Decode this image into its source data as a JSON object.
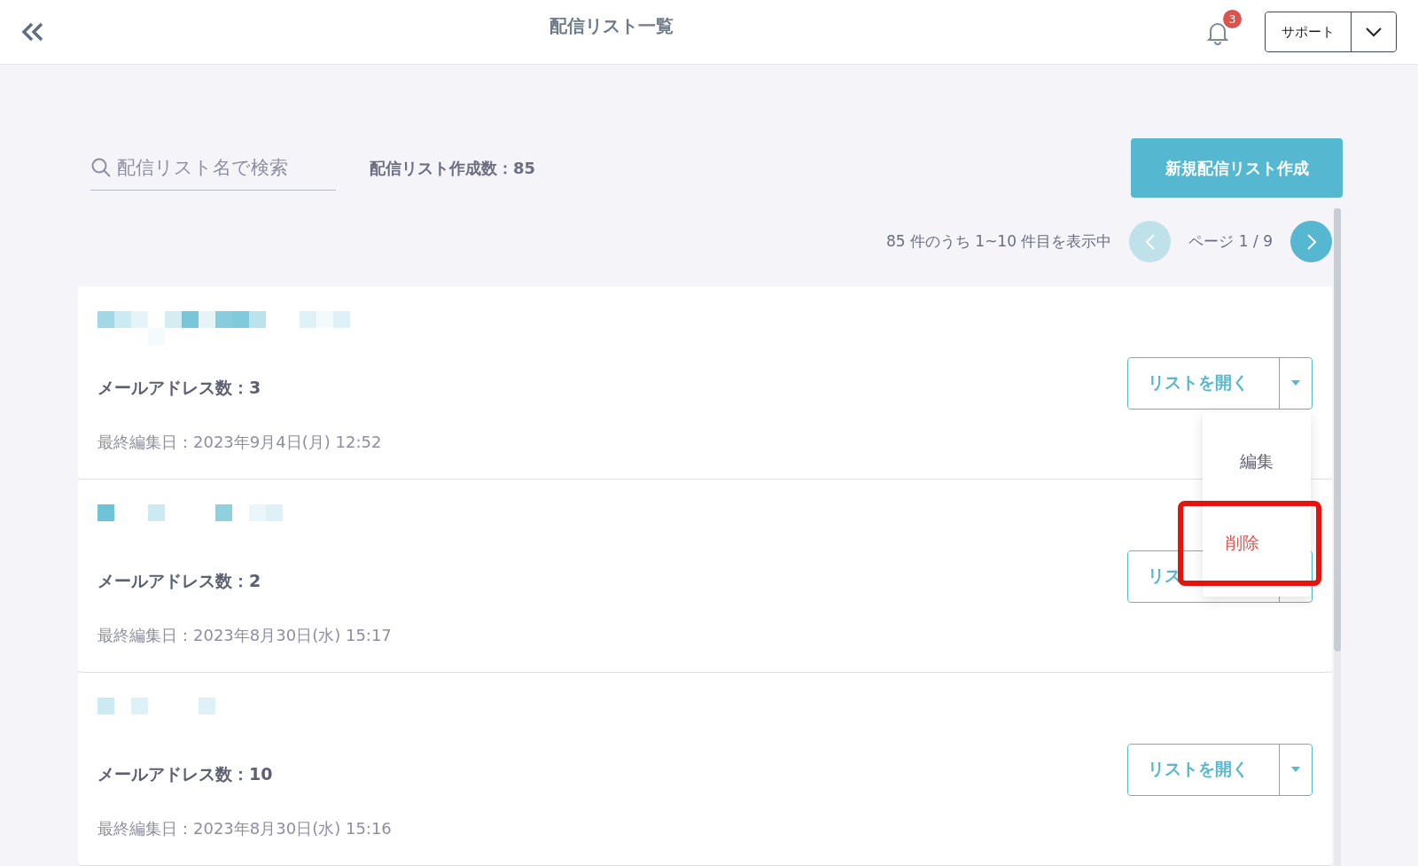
{
  "header": {
    "title": "配信リスト一覧",
    "notification_count": "3",
    "support_button": "サポート"
  },
  "toolbar": {
    "search": {
      "placeholder": "配信リスト名で検索"
    },
    "list_count": "配信リスト作成数：85",
    "new_button": "新規配信リスト作成"
  },
  "pagination": {
    "summary": "85 件のうち 1~10 件目を表示中",
    "page": "ページ 1 / 9",
    "prev_disabled": true,
    "next_disabled": false
  },
  "lists": [
    {
      "address_count": "メールアドレス数：3",
      "last_edited": "最終編集日：2023年9月4日(月) 12:52",
      "open_button": "リストを開く",
      "menu_open": true,
      "menu": [
        {
          "label": "編集",
          "kind": "normal",
          "highlighted": false
        },
        {
          "label": "削除",
          "kind": "danger",
          "highlighted": true
        }
      ]
    },
    {
      "address_count": "メールアドレス数：2",
      "last_edited": "最終編集日：2023年8月30日(水) 15:17",
      "open_button": "リス"
    },
    {
      "address_count": "メールアドレス数：10",
      "last_edited": "最終編集日：2023年8月30日(水) 15:16",
      "open_button": "リストを開く"
    }
  ]
}
